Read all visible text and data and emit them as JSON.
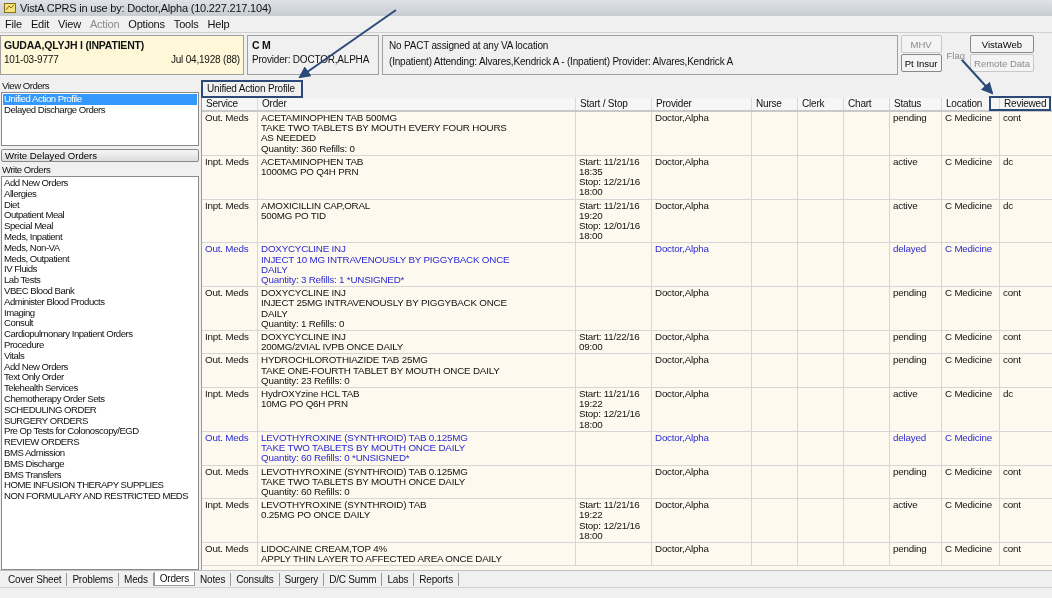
{
  "window": {
    "title": "VistA CPRS in use by: Doctor,Alpha  (10.227.217.104)"
  },
  "menu": [
    {
      "label": "File",
      "disabled": false
    },
    {
      "label": "Edit",
      "disabled": false
    },
    {
      "label": "View",
      "disabled": false
    },
    {
      "label": "Action",
      "disabled": true
    },
    {
      "label": "Options",
      "disabled": false
    },
    {
      "label": "Tools",
      "disabled": false
    },
    {
      "label": "Help",
      "disabled": false
    }
  ],
  "patient": {
    "name": "GUDAA,QLYJH I (INPATIENT)",
    "ssn": "101-03-9777",
    "dob": "Jul 04,1928 (88)"
  },
  "team": {
    "title": "C M",
    "provider": "Provider:  DOCTOR,ALPHA"
  },
  "location_info": {
    "line_1": "No PACT assigned at any VA location",
    "line_2": "(Inpatient) Attending:  Alvares,Kendrick A - (Inpatient) Provider: Alvares,Kendrick A"
  },
  "header_buttons": [
    {
      "label": "MHV",
      "disabled": true
    },
    {
      "label": "Pt Insur",
      "disabled": false
    },
    {
      "label": "Flag",
      "disabled": true
    },
    {
      "label": "VistaWeb",
      "disabled": false
    },
    {
      "label": "Remote Data",
      "disabled": true
    }
  ],
  "view_orders": {
    "label": "View Orders",
    "items": [
      {
        "label": "Unified Action Profile",
        "selected": true
      },
      {
        "label": "Delayed Discharge Orders",
        "selected": false
      }
    ]
  },
  "write_delayed_button": "Write Delayed Orders",
  "write_orders": {
    "label": "Write Orders",
    "items": [
      {
        "label": "Add New Orders",
        "selected": false
      },
      {
        "label": "Allergies",
        "selected": false
      },
      {
        "label": "Diet",
        "selected": false
      },
      {
        "label": "Outpatient Meal",
        "selected": false
      },
      {
        "label": "Special Meal",
        "selected": false
      },
      {
        "label": "Meds, Inpatient",
        "selected": false
      },
      {
        "label": "Meds, Non-VA",
        "selected": false
      },
      {
        "label": "Meds, Outpatient",
        "selected": false
      },
      {
        "label": "IV Fluids",
        "selected": false
      },
      {
        "label": "Lab Tests",
        "selected": false
      },
      {
        "label": "VBEC Blood Bank",
        "selected": false
      },
      {
        "label": "Administer Blood Products",
        "selected": false
      },
      {
        "label": "Imaging",
        "selected": false
      },
      {
        "label": "Consult",
        "selected": false
      },
      {
        "label": "Cardiopulmonary Inpatient Orders",
        "selected": false
      },
      {
        "label": "Procedure",
        "selected": false
      },
      {
        "label": "Vitals",
        "selected": false
      },
      {
        "label": "Add New Orders",
        "selected": false
      },
      {
        "label": "Text Only Order",
        "selected": false
      },
      {
        "label": "Telehealth Services",
        "selected": false
      },
      {
        "label": "Chemotherapy Order Sets",
        "selected": false
      },
      {
        "label": "SCHEDULING ORDER",
        "selected": false
      },
      {
        "label": "SURGERY ORDERS",
        "selected": false
      },
      {
        "label": "Pre Op Tests for Colonoscopy/EGD",
        "selected": false
      },
      {
        "label": "REVIEW ORDERS",
        "selected": false
      },
      {
        "label": "BMS Admission",
        "selected": false
      },
      {
        "label": "BMS Discharge",
        "selected": false
      },
      {
        "label": "BMS Transfers",
        "selected": false
      },
      {
        "label": "HOME INFUSION THERAPY SUPPLIES",
        "selected": false
      },
      {
        "label": "NON FORMULARY AND RESTRICTED MEDS",
        "selected": false
      }
    ]
  },
  "orders_table": {
    "title": "Unified Action Profile",
    "columns": [
      "Service",
      "Order",
      "Start / Stop",
      "Provider",
      "Nurse",
      "Clerk",
      "Chart",
      "Status",
      "Location",
      "Reviewed"
    ],
    "rows": [
      {
        "service": "Out. Meds",
        "order": [
          "ACETAMINOPHEN TAB  500MG",
          "TAKE TWO TABLETS BY MOUTH EVERY FOUR HOURS",
          "AS NEEDED",
          "Quantity: 360 Refills: 0"
        ],
        "start_stop": [],
        "provider": "Doctor,Alpha",
        "status": "pending",
        "location": "C Medicine",
        "reviewed": "cont",
        "unsigned": false
      },
      {
        "service": "Inpt. Meds",
        "order": [
          "ACETAMINOPHEN TAB",
          "1000MG PO Q4H PRN"
        ],
        "start_stop": [
          "Start: 11/21/16",
          "18:35",
          "Stop: 12/21/16",
          "18:00"
        ],
        "provider": "Doctor,Alpha",
        "status": "active",
        "location": "C Medicine",
        "reviewed": "dc",
        "unsigned": false
      },
      {
        "service": "Inpt. Meds",
        "order": [
          "AMOXICILLIN CAP,ORAL",
          "500MG PO TID"
        ],
        "start_stop": [
          "Start: 11/21/16",
          "19:20",
          "Stop: 12/01/16",
          "18:00"
        ],
        "provider": "Doctor,Alpha",
        "status": "active",
        "location": "C Medicine",
        "reviewed": "dc",
        "unsigned": false
      },
      {
        "service": "Out. Meds",
        "order": [
          "DOXYCYCLINE INJ",
          "INJECT 10 MG INTRAVENOUSLY BY PIGGYBACK ONCE",
          "DAILY",
          "Quantity: 3 Refills: 1 *UNSIGNED*"
        ],
        "start_stop": [],
        "provider": "Doctor,Alpha",
        "status": "delayed",
        "location": "C Medicine",
        "reviewed": "",
        "unsigned": true
      },
      {
        "service": "Out. Meds",
        "order": [
          "DOXYCYCLINE INJ",
          "INJECT 25MG INTRAVENOUSLY BY PIGGYBACK ONCE",
          "DAILY",
          "Quantity: 1 Refills: 0"
        ],
        "start_stop": [],
        "provider": "Doctor,Alpha",
        "status": "pending",
        "location": "C Medicine",
        "reviewed": "cont",
        "unsigned": false
      },
      {
        "service": "Inpt. Meds",
        "order": [
          "DOXYCYCLINE INJ",
          "200MG/2VIAL IVPB ONCE DAILY"
        ],
        "start_stop": [
          "Start: 11/22/16",
          "09:00"
        ],
        "provider": "Doctor,Alpha",
        "status": "pending",
        "location": "C Medicine",
        "reviewed": "cont",
        "unsigned": false
      },
      {
        "service": "Out. Meds",
        "order": [
          "HYDROCHLOROTHIAZIDE TAB  25MG",
          "TAKE ONE-FOURTH TABLET BY MOUTH ONCE DAILY",
          "Quantity: 23 Refills: 0"
        ],
        "start_stop": [],
        "provider": "Doctor,Alpha",
        "status": "pending",
        "location": "C Medicine",
        "reviewed": "cont",
        "unsigned": false
      },
      {
        "service": "Inpt. Meds",
        "order": [
          "HydrOXYzine HCL TAB",
          "10MG PO Q6H PRN"
        ],
        "start_stop": [
          "Start: 11/21/16",
          "19:22",
          "Stop: 12/21/16",
          "18:00"
        ],
        "provider": "Doctor,Alpha",
        "status": "active",
        "location": "C Medicine",
        "reviewed": "dc",
        "unsigned": false
      },
      {
        "service": "Out. Meds",
        "order": [
          "LEVOTHYROXINE (SYNTHROID) TAB  0.125MG",
          "TAKE TWO TABLETS BY MOUTH ONCE DAILY",
          "Quantity: 60 Refills: 0 *UNSIGNED*"
        ],
        "start_stop": [],
        "provider": "Doctor,Alpha",
        "status": "delayed",
        "location": "C Medicine",
        "reviewed": "",
        "unsigned": true
      },
      {
        "service": "Out. Meds",
        "order": [
          "LEVOTHYROXINE (SYNTHROID) TAB  0.125MG",
          "TAKE TWO TABLETS BY MOUTH ONCE DAILY",
          "Quantity: 60 Refills: 0"
        ],
        "start_stop": [],
        "provider": "Doctor,Alpha",
        "status": "pending",
        "location": "C Medicine",
        "reviewed": "cont",
        "unsigned": false
      },
      {
        "service": "Inpt. Meds",
        "order": [
          "LEVOTHYROXINE (SYNTHROID) TAB",
          "0.25MG PO ONCE DAILY"
        ],
        "start_stop": [
          "Start: 11/21/16",
          "19:22",
          "Stop: 12/21/16",
          "18:00"
        ],
        "provider": "Doctor,Alpha",
        "status": "active",
        "location": "C Medicine",
        "reviewed": "cont",
        "unsigned": false
      },
      {
        "service": "Out. Meds",
        "order": [
          "LIDOCAINE CREAM,TOP  4%",
          "APPLY THIN LAYER TO AFFECTED AREA ONCE DAILY"
        ],
        "start_stop": [],
        "provider": "Doctor,Alpha",
        "status": "pending",
        "location": "C Medicine",
        "reviewed": "cont",
        "unsigned": false
      }
    ]
  },
  "tabs": [
    {
      "label": "Cover Sheet",
      "selected": false
    },
    {
      "label": "Problems",
      "selected": false
    },
    {
      "label": "Meds",
      "selected": false
    },
    {
      "label": "Orders",
      "selected": true
    },
    {
      "label": "Notes",
      "selected": false
    },
    {
      "label": "Consults",
      "selected": false
    },
    {
      "label": "Surgery",
      "selected": false
    },
    {
      "label": "D/C Summ",
      "selected": false
    },
    {
      "label": "Labs",
      "selected": false
    },
    {
      "label": "Reports",
      "selected": false
    }
  ]
}
